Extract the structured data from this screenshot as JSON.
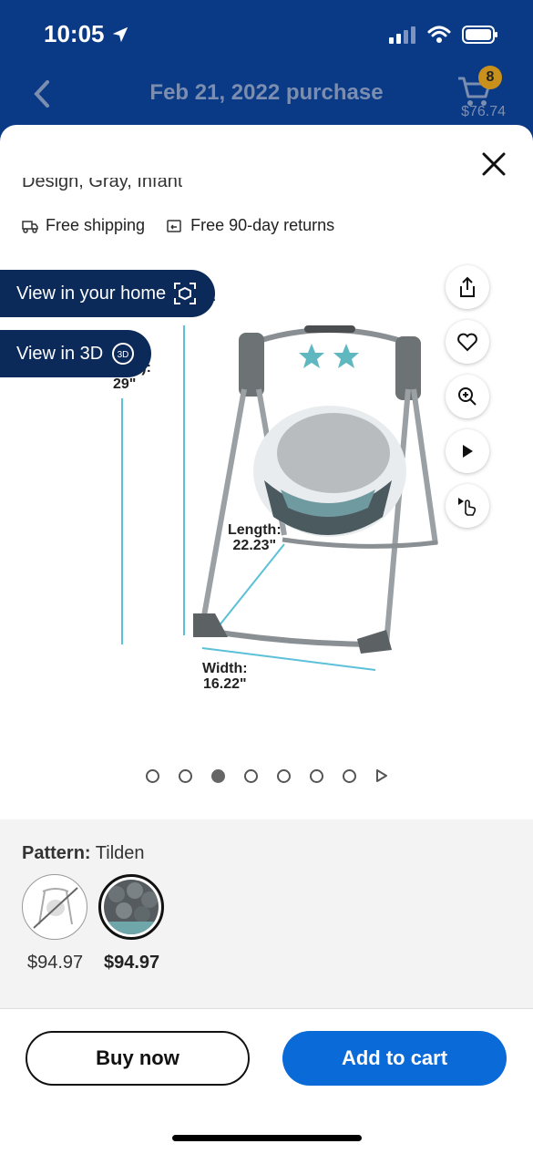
{
  "status": {
    "time": "10:05"
  },
  "nav": {
    "title": "Feb 21, 2022 purchase",
    "cart_count": "8",
    "cart_total": "$76.74"
  },
  "product": {
    "title_fragment": "Design, Gray, Infant",
    "perks": [
      "Free shipping",
      "Free 90-day returns"
    ]
  },
  "image": {
    "view_home_label": "View in your home",
    "view_3d_label": "View in 3D",
    "dims": {
      "height_label": "29\"",
      "partial_label": "t):",
      "partial_label2": ":",
      "length_label": "Length:",
      "length_value": "22.23\"",
      "width_label": "Width:",
      "width_value": "16.22\""
    },
    "carousel": {
      "count": 7,
      "active_index": 2
    }
  },
  "variants": {
    "label": "Pattern:",
    "selected": "Tilden",
    "options": [
      {
        "price": "$94.97",
        "available": false
      },
      {
        "price": "$94.97",
        "available": true,
        "selected": true
      }
    ]
  },
  "actions": {
    "buy_now": "Buy now",
    "add_to_cart": "Add to cart"
  },
  "colors": {
    "nav_bg": "#0a3a86",
    "primary": "#0a6ad8",
    "pill_bg": "#0b2a5a",
    "dimension_line": "#5bc0d8"
  }
}
